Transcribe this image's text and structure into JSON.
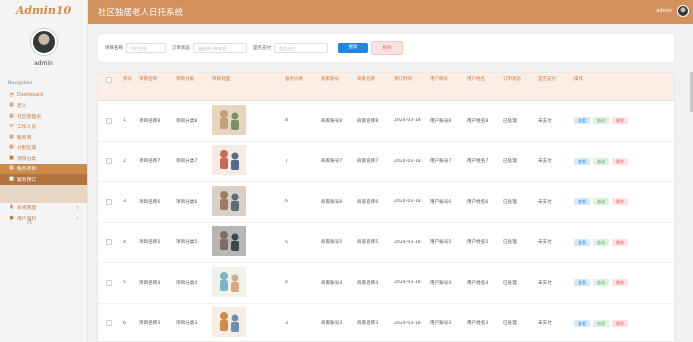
{
  "sidebar": {
    "brand": "Admin10",
    "username": "admin",
    "caption": "Navigation",
    "items": [
      {
        "icon": "gauge-icon",
        "glyph": "◔",
        "label": "Dashboard"
      },
      {
        "icon": "grid-icon",
        "glyph": "▦",
        "label": "老人"
      },
      {
        "icon": "grid-icon",
        "glyph": "▦",
        "label": "社区管理员"
      },
      {
        "icon": "list-icon",
        "glyph": "≡",
        "label": "工作人员"
      },
      {
        "icon": "grid-icon",
        "glyph": "▦",
        "label": "服务商"
      },
      {
        "icon": "grid-icon",
        "glyph": "▦",
        "label": "分配区域"
      },
      {
        "icon": "folder-icon",
        "glyph": "■",
        "label": "项目分类"
      },
      {
        "icon": "grid-icon",
        "glyph": "▦",
        "label": "服务项目"
      },
      {
        "icon": "folder-icon",
        "glyph": "■",
        "label": "服务预订"
      }
    ],
    "bottom_items": [
      {
        "icon": "chart-icon",
        "glyph": "▮",
        "label": "系统管理"
      },
      {
        "icon": "user-icon",
        "glyph": "●",
        "label": "用户资料"
      }
    ]
  },
  "header": {
    "title": "社区独居老人日托系统",
    "user": "admin"
  },
  "search": {
    "name_label": "项目名称",
    "name_placeholder": "项目名称",
    "status_label": "订单状态",
    "status_placeholder": "请选择订单状态",
    "paid_label": "是否支付",
    "paid_placeholder": "是否支付",
    "search_button": "搜索",
    "delete_button": "删除"
  },
  "table": {
    "headers": [
      "",
      "序号",
      "项目名称",
      "项目分类",
      "项目封面",
      "服务价格",
      "商家账号",
      "商家名称",
      "预订时间",
      "用户账号",
      "用户姓名",
      "订单状态",
      "是否支付",
      "操作"
    ],
    "rows": [
      {
        "index": "1",
        "name": "项目名称8",
        "category": "项目分类8",
        "price": "8",
        "seller_account": "商家账号8",
        "seller_name": "商家名称8",
        "time": "2024-03-18",
        "user_account": "用户账号8",
        "user_name": "用户姓名8",
        "status": "已处理",
        "paid": "未支付",
        "thumb_colors": [
          "#e8d5c0",
          "#c2a07d",
          "#7a8f6b"
        ]
      },
      {
        "index": "2",
        "name": "项目名称7",
        "category": "项目分类7",
        "price": "7",
        "seller_account": "商家账号7",
        "seller_name": "商家名称7",
        "time": "2024-03-18",
        "user_account": "用户账号7",
        "user_name": "用户姓名7",
        "status": "已处理",
        "paid": "未支付",
        "thumb_colors": [
          "#f4ebe3",
          "#c86a5a",
          "#556a88"
        ]
      },
      {
        "index": "3",
        "name": "项目名称6",
        "category": "项目分类6",
        "price": "6",
        "seller_account": "商家账号6",
        "seller_name": "商家名称6",
        "time": "2024-03-18",
        "user_account": "用户账号6",
        "user_name": "用户姓名6",
        "status": "已处理",
        "paid": "未支付",
        "thumb_colors": [
          "#d9d1c8",
          "#9c7a63",
          "#5a6d78"
        ]
      },
      {
        "index": "4",
        "name": "项目名称5",
        "category": "项目分类5",
        "price": "5",
        "seller_account": "商家账号5",
        "seller_name": "商家名称5",
        "time": "2024-03-18",
        "user_account": "用户账号5",
        "user_name": "用户姓名5",
        "status": "已处理",
        "paid": "未支付",
        "thumb_colors": [
          "#b8b6b2",
          "#7c6e66",
          "#3e4650"
        ]
      },
      {
        "index": "5",
        "name": "项目名称4",
        "category": "项目分类4",
        "price": "4",
        "seller_account": "商家账号4",
        "seller_name": "商家名称4",
        "time": "2024-03-18",
        "user_account": "用户账号4",
        "user_name": "用户姓名4",
        "status": "已处理",
        "paid": "未支付",
        "thumb_colors": [
          "#f2f1ea",
          "#7fb3c8",
          "#d8a880"
        ]
      },
      {
        "index": "6",
        "name": "项目名称3",
        "category": "项目分类3",
        "price": "3",
        "seller_account": "商家账号3",
        "seller_name": "商家名称3",
        "time": "2024-03-18",
        "user_account": "用户账号3",
        "user_name": "用户姓名3",
        "status": "已处理",
        "paid": "未支付",
        "thumb_colors": [
          "#f6efe6",
          "#d08a4a",
          "#6d8fb0"
        ]
      }
    ],
    "actions": {
      "view": "查看",
      "edit": "修改",
      "delete": "删除"
    }
  }
}
